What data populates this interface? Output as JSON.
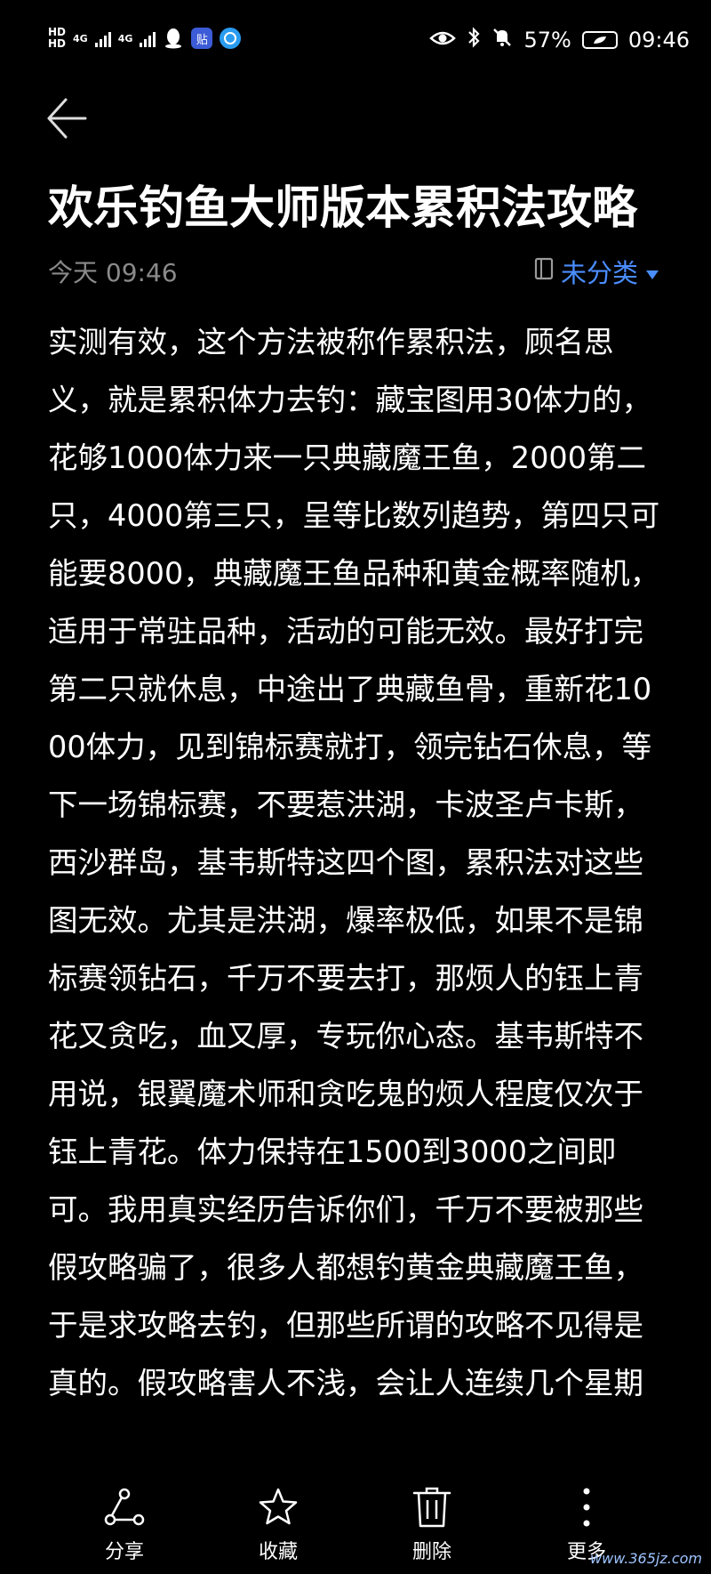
{
  "status_bar": {
    "hd1": "HD",
    "hd2": "HD",
    "net1": "4G",
    "net2": "4G",
    "battery_percent": "57%",
    "time": "09:46"
  },
  "note": {
    "title": "欢乐钓鱼大师版本累积法攻略",
    "date": "今天 09:46",
    "category": "未分类",
    "body": "实测有效，这个方法被称作累积法，顾名思义，就是累积体力去钓：藏宝图用30体力的，花够1000体力来一只典藏魔王鱼，2000第二只，4000第三只，呈等比数列趋势，第四只可能要8000，典藏魔王鱼品种和黄金概率随机，适用于常驻品种，活动的可能无效。最好打完第二只就休息，中途出了典藏鱼骨，重新花1000体力，见到锦标赛就打，领完钻石休息，等下一场锦标赛，不要惹洪湖，卡波圣卢卡斯，西沙群岛，基韦斯特这四个图，累积法对这些图无效。尤其是洪湖，爆率极低，如果不是锦标赛领钻石，千万不要去打，那烦人的钰上青花又贪吃，血又厚，专玩你心态。基韦斯特不用说，银翼魔术师和贪吃鬼的烦人程度仅次于钰上青花。体力保持在1500到3000之间即可。我用真实经历告诉你们，千万不要被那些假攻略骗了，很多人都想钓黄金典藏魔王鱼，于是求攻略去钓，但那些所谓的攻略不见得是真的。假攻略害人不浅，会让人连续几个星期"
  },
  "actions": {
    "share": "分享",
    "favorite": "收藏",
    "delete": "删除",
    "more": "更多"
  },
  "watermark": "www.365jz.com",
  "colors": {
    "accent": "#4a8dff",
    "background": "#000000",
    "date_gray": "#8a8a8a"
  }
}
